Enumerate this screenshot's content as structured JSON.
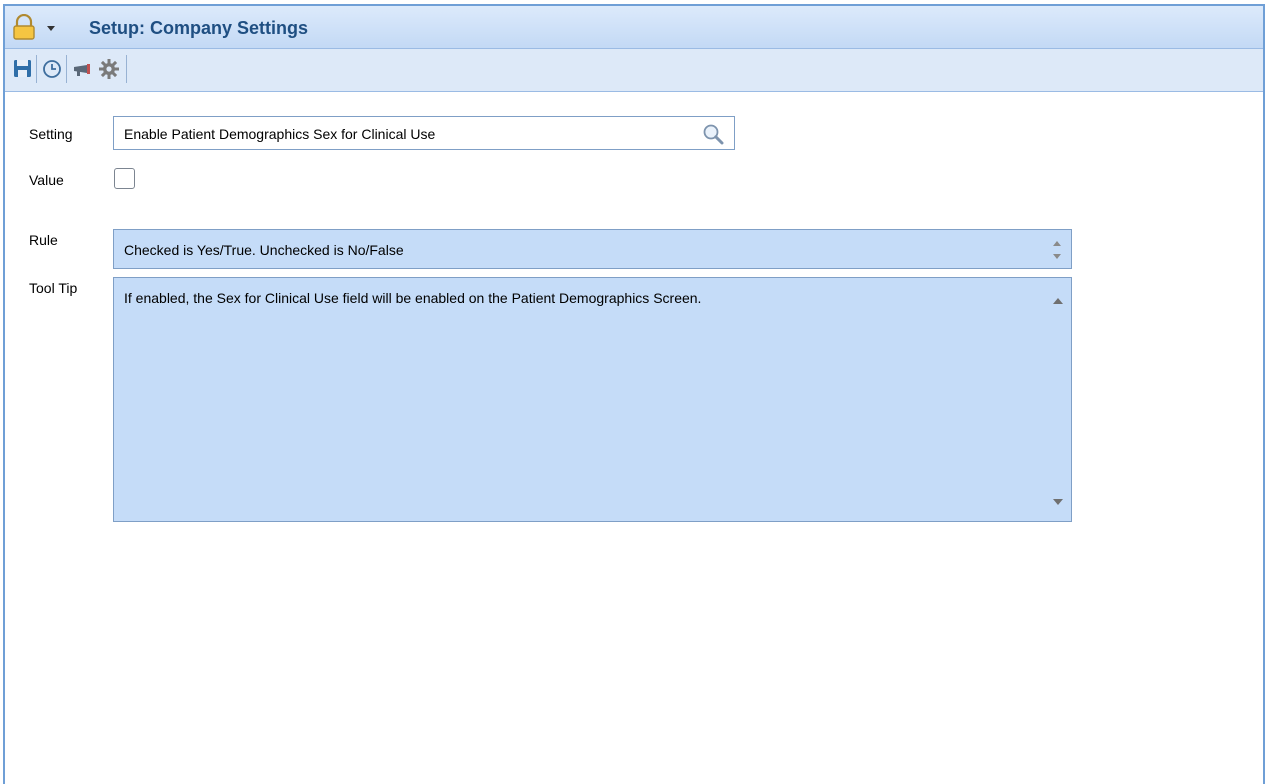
{
  "window": {
    "title": "Setup: Company Settings"
  },
  "toolbar": {
    "icons": [
      "save-icon",
      "history-icon",
      "megaphone-icon",
      "gear-icon"
    ]
  },
  "form": {
    "setting_label": "Setting",
    "setting_value": "Enable Patient Demographics Sex for Clinical Use",
    "value_label": "Value",
    "value_checked": false,
    "rule_label": "Rule",
    "rule_value": "Checked is Yes/True. Unchecked is No/False",
    "tooltip_label": "Tool Tip",
    "tooltip_value": "If enabled, the Sex for Clinical Use field will be enabled on the Patient Demographics Screen."
  },
  "colors": {
    "title": "#1f4f82",
    "readonly_field_bg": "#c5dcf8",
    "border": "#6f9fd6"
  }
}
